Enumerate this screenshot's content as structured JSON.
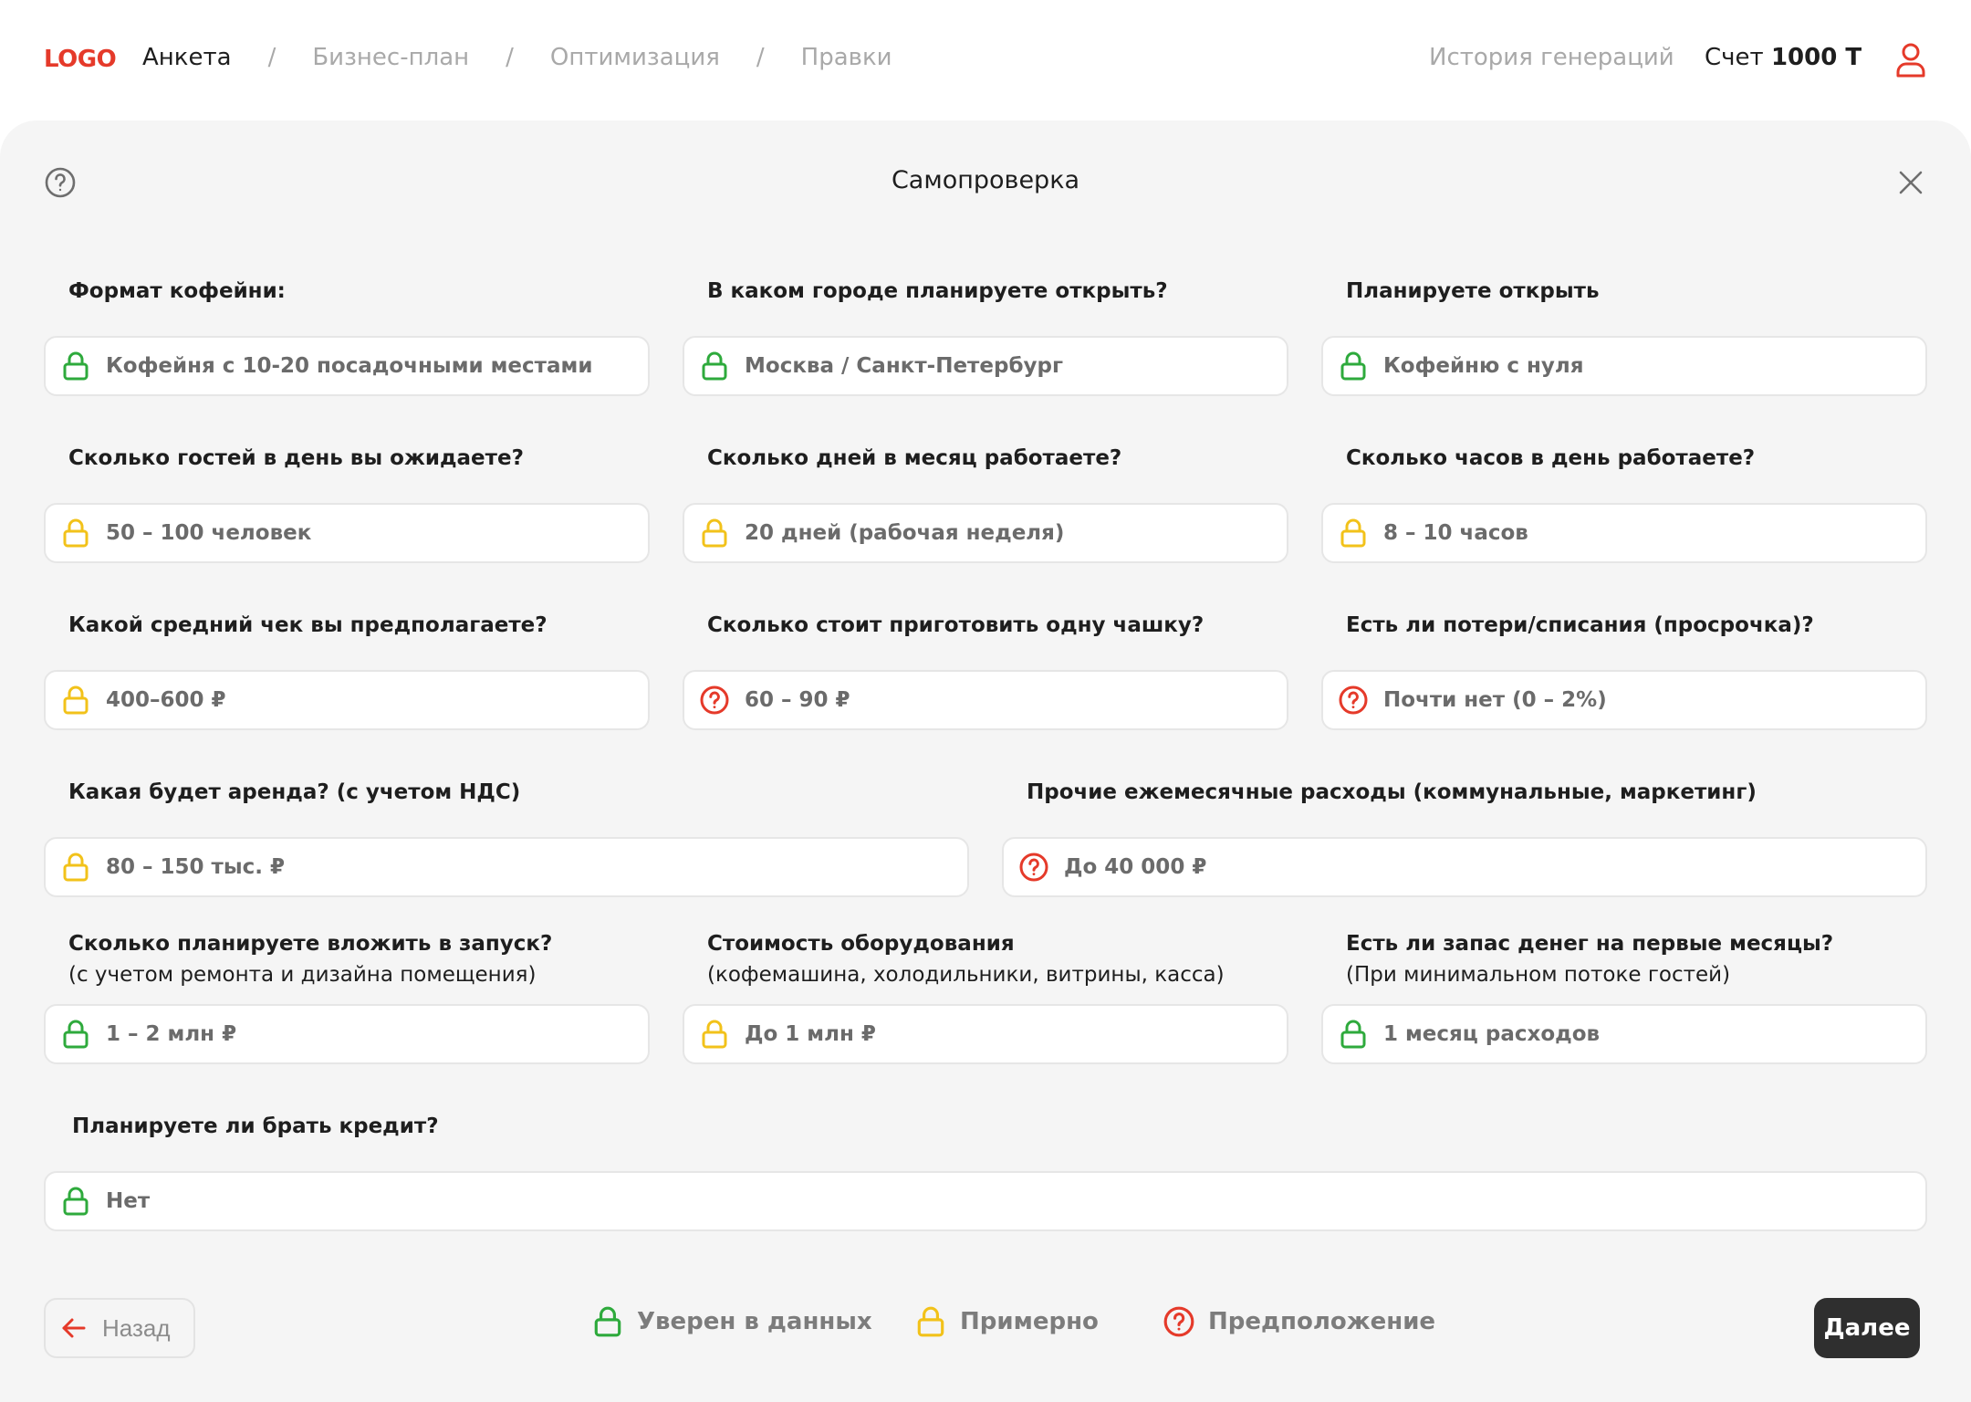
{
  "header": {
    "logo": "LOGO",
    "breadcrumbs": [
      {
        "label": "Анкета",
        "active": true
      },
      {
        "label": "Бизнес-план",
        "active": false
      },
      {
        "label": "Оптимизация",
        "active": false
      },
      {
        "label": "Правки",
        "active": false
      }
    ],
    "separator": "/",
    "history_link": "История генераций",
    "balance_prefix": "Счет",
    "balance_value": "1000 Т",
    "user_icon": "user-icon"
  },
  "panel": {
    "title": "Самопроверка",
    "help_icon": "question-circle-icon",
    "close_icon": "close-icon"
  },
  "colors": {
    "confident": "#2eaa3c",
    "approximate": "#f2c21a",
    "assumption": "#e53a2a",
    "brand": "#e53a2a"
  },
  "fields": [
    {
      "label": "Формат кофейни:",
      "value": "Кофейня с 10-20 посадочными местами",
      "status": "confident"
    },
    {
      "label": "В каком городе планируете открыть?",
      "value": "Москва / Санкт-Петербург",
      "status": "confident"
    },
    {
      "label": "Планируете открыть",
      "value": "Кофейню с нуля",
      "status": "confident"
    },
    {
      "label": "Сколько гостей в день вы ожидаете?",
      "value": "50 – 100 человек",
      "status": "approximate"
    },
    {
      "label": "Сколько дней в месяц работаете?",
      "value": "20 дней (рабочая неделя)",
      "status": "approximate"
    },
    {
      "label": "Сколько часов в день работаете?",
      "value": "8 – 10 часов",
      "status": "approximate"
    },
    {
      "label": "Какой средний чек вы предполагаете?",
      "value": "400–600 ₽",
      "status": "approximate"
    },
    {
      "label": "Сколько стоит приготовить одну чашку?",
      "value": "60 – 90 ₽",
      "status": "assumption"
    },
    {
      "label": "Есть ли потери/списания (просрочка)?",
      "value": "Почти нет (0 – 2%)",
      "status": "assumption"
    },
    {
      "label": "Какая будет аренда? (с учетом НДС)",
      "value": "80 – 150 тыс. ₽",
      "status": "approximate"
    },
    {
      "label": "Прочие ежемесячные расходы (коммунальные, маркетинг)",
      "value": "До 40 000 ₽",
      "status": "assumption"
    },
    {
      "label": "Сколько планируете вложить в запуск?",
      "sublabel": "(с учетом ремонта и дизайна помещения)",
      "value": "1 – 2 млн ₽",
      "status": "confident"
    },
    {
      "label": "Стоимость оборудования",
      "sublabel": "(кофемашина, холодильники, витрины, касса)",
      "value": "До 1 млн ₽",
      "status": "approximate"
    },
    {
      "label": "Есть ли запас денег на первые месяцы?",
      "sublabel": "(При минимальном потоке гостей)",
      "value": "1 месяц расходов",
      "status": "confident"
    },
    {
      "label": "Планируете ли брать кредит?",
      "value": "Нет",
      "status": "confident"
    }
  ],
  "footer": {
    "back_label": "Назад",
    "legend": [
      {
        "status": "confident",
        "label": "Уверен в данных"
      },
      {
        "status": "approximate",
        "label": "Примерно"
      },
      {
        "status": "assumption",
        "label": "Предположение"
      }
    ],
    "next_label": "Далее"
  }
}
